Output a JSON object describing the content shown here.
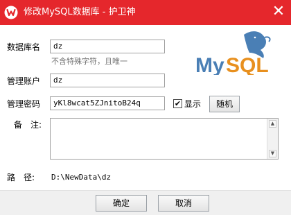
{
  "window": {
    "title": "修改MySQL数据库 - 护卫神",
    "close_glyph": "✕",
    "accent_color": "#e5272c",
    "logo_icon": "mysql-dolphin-logo"
  },
  "form": {
    "db_name": {
      "label": "数据库名",
      "value": "dz",
      "hint": "不含特殊字符，且唯一"
    },
    "account": {
      "label": "管理账户",
      "value": "dz"
    },
    "password": {
      "label": "管理密码",
      "value": "yKl8wcat5ZJnitoB24q",
      "show_label": "显示",
      "show_checked": "✔",
      "random_label": "随机"
    },
    "notes": {
      "label": "备　注:",
      "value": ""
    },
    "path": {
      "label": "路　径:",
      "value": "D:\\NewData\\dz"
    }
  },
  "footer": {
    "ok_label": "确定",
    "cancel_label": "取消"
  }
}
